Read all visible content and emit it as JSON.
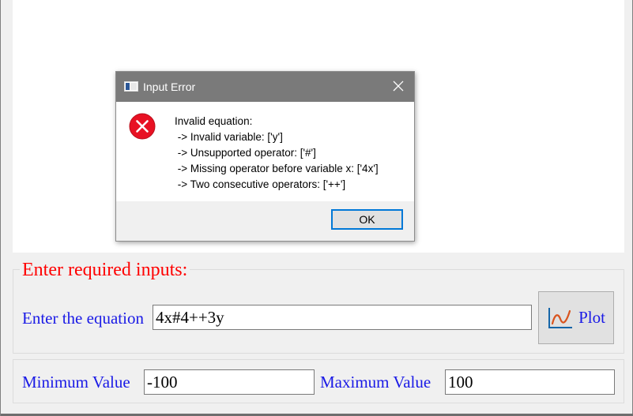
{
  "inputs_group": {
    "title": "Enter required inputs:",
    "equation_label": "Enter the equation",
    "equation_value": "4x#4++3y",
    "plot_button_label": "Plot",
    "plot_button_icon": "line-chart-icon"
  },
  "range_group": {
    "min_label": "Minimum Value",
    "min_value": "-100",
    "max_label": "Maximum Value",
    "max_value": "100"
  },
  "dialog": {
    "title": "Input Error",
    "icon": "error-icon",
    "message_lines": [
      "Invalid equation:",
      " -> Invalid variable: ['y']",
      " -> Unsupported operator: ['#']",
      " -> Missing operator before variable x: ['4x']",
      " -> Two consecutive operators: ['++']"
    ],
    "ok_label": "OK"
  },
  "colors": {
    "title_red": "#ff0000",
    "label_blue": "#1a1ae6",
    "dialog_titlebar": "#7a7a7a",
    "error_red": "#e81123",
    "focus_blue": "#0078d7"
  }
}
